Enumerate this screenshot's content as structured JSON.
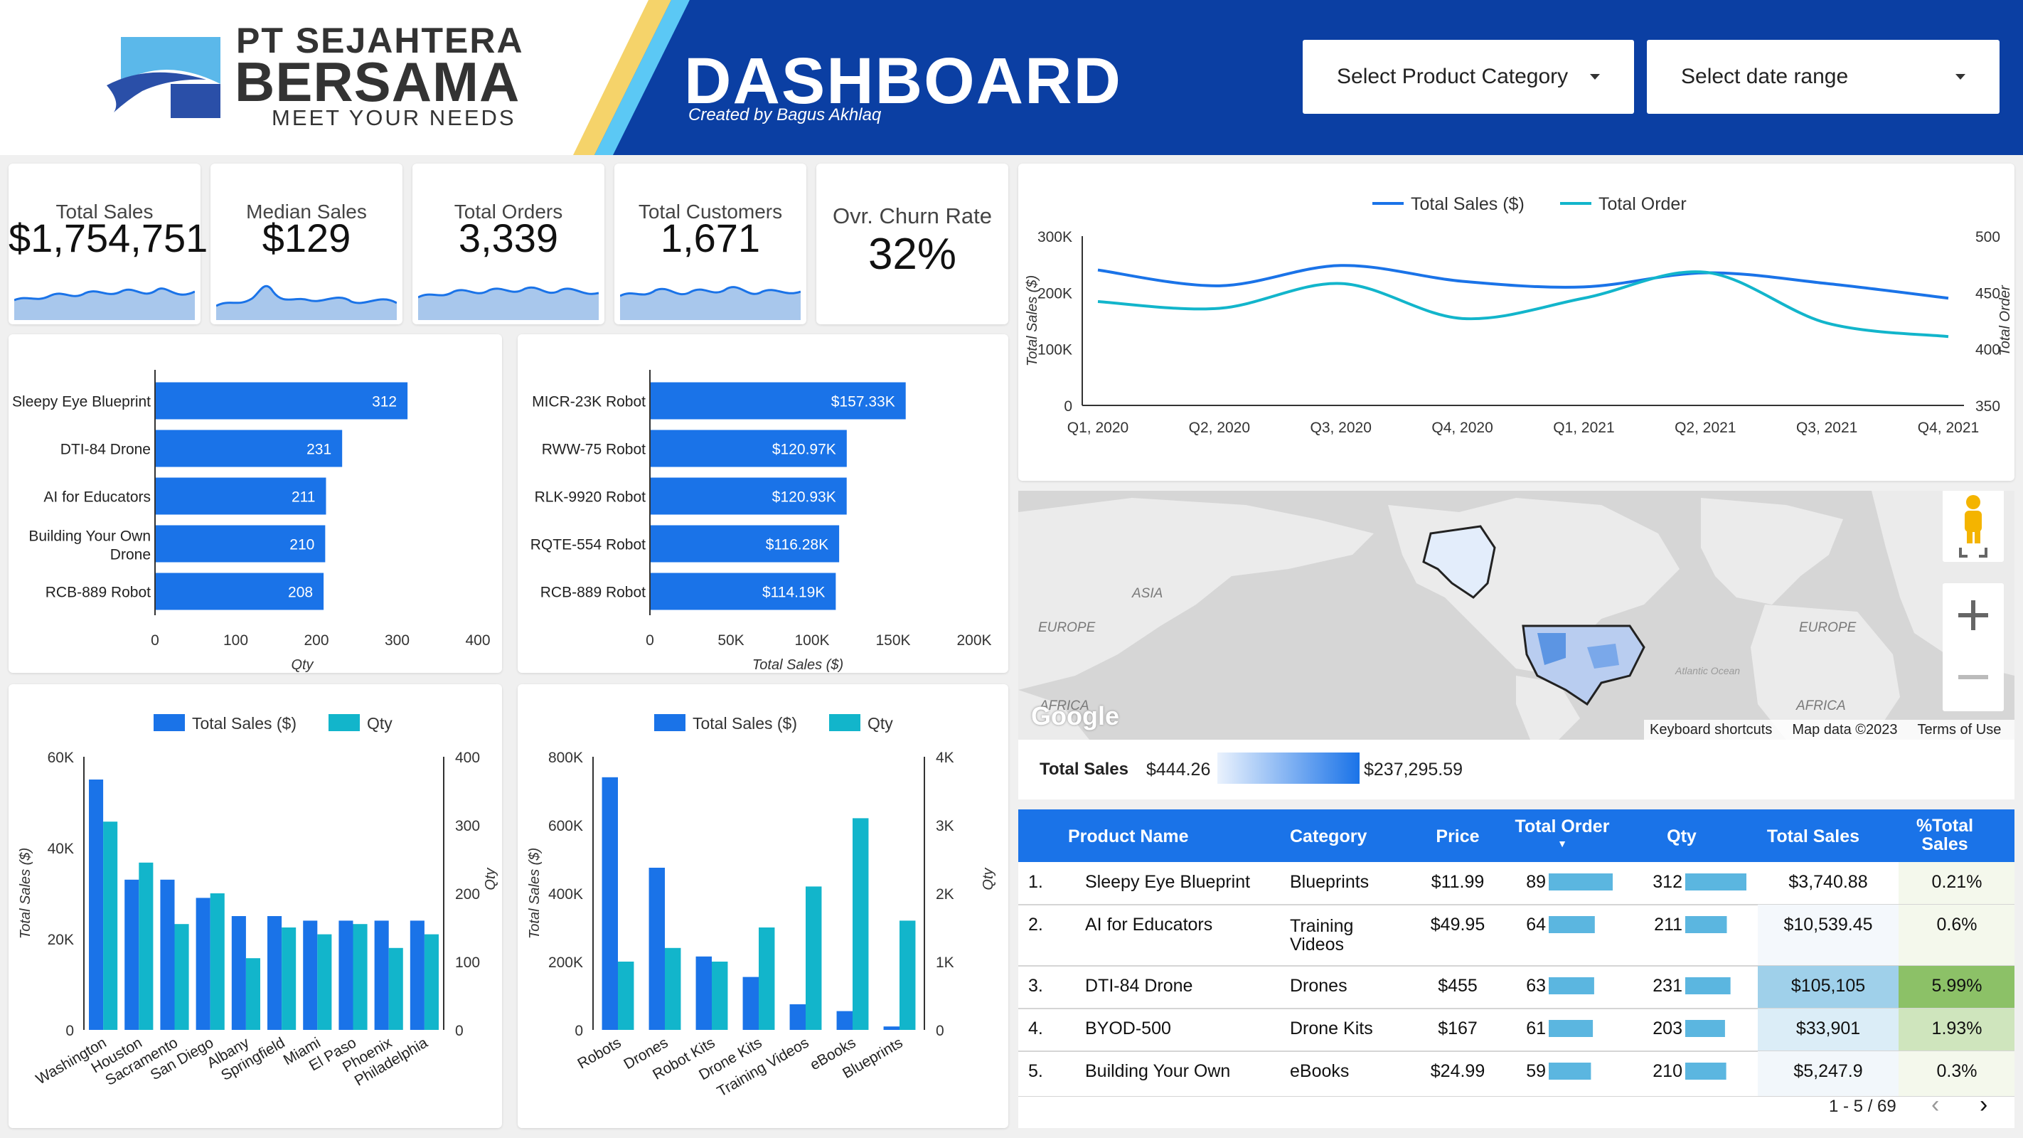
{
  "header": {
    "brand_line1": "PT SEJAHTERA",
    "brand_line2": "BERSAMA",
    "brand_line3": "MEET YOUR NEEDS",
    "title": "DASHBOARD",
    "subtitle": "Created by Bagus Akhlaq",
    "selectors": [
      {
        "label": "Select Product Category"
      },
      {
        "label": "Select date range"
      }
    ],
    "colors": {
      "blue": "#0b3fa3",
      "accent_yellow": "#f5d36a",
      "accent_cyan": "#5bc8f5"
    }
  },
  "kpis": [
    {
      "label": "Total Sales",
      "value": "$1,754,751"
    },
    {
      "label": "Median Sales",
      "value": "$129"
    },
    {
      "label": "Total Orders",
      "value": "3,339"
    },
    {
      "label": "Total Customers",
      "value": "1,671"
    },
    {
      "label": "Ovr. Churn Rate",
      "value": "32%"
    }
  ],
  "chart_data": [
    {
      "type": "line",
      "legend": [
        "Total Sales ($)",
        "Total Order"
      ],
      "x": [
        "Q1, 2020",
        "Q2, 2020",
        "Q3, 2020",
        "Q4, 2020",
        "Q1, 2021",
        "Q2, 2021",
        "Q3, 2021",
        "Q4, 2021"
      ],
      "series": [
        {
          "name": "Total Sales ($)",
          "axis": "left",
          "values": [
            240000,
            212000,
            248000,
            220000,
            210000,
            235000,
            216000,
            190000
          ],
          "color": "#1a73e8"
        },
        {
          "name": "Total Order",
          "axis": "right",
          "values": [
            442,
            436,
            458,
            427,
            445,
            468,
            423,
            411
          ],
          "color": "#12b5cb"
        }
      ],
      "ylabel": "Total Sales ($)",
      "y2label": "Total Order",
      "ylim": [
        0,
        300000
      ],
      "y2lim": [
        350,
        500
      ],
      "yticks": [
        "0",
        "100K",
        "200K",
        "300K"
      ],
      "y2ticks": [
        "350",
        "400",
        "450",
        "500"
      ]
    },
    {
      "type": "bar",
      "orientation": "horizontal",
      "categories": [
        "Sleepy Eye Blueprint",
        "DTI-84 Drone",
        "AI for Educators",
        "Building Your Own Drone",
        "RCB-889 Robot"
      ],
      "values": [
        312,
        231,
        211,
        210,
        208
      ],
      "labels": [
        "312",
        "231",
        "211",
        "210",
        "208"
      ],
      "xlabel": "Qty",
      "xlim": [
        0,
        400
      ],
      "xticks": [
        "0",
        "100",
        "200",
        "300",
        "400"
      ],
      "color": "#1a73e8"
    },
    {
      "type": "bar",
      "orientation": "horizontal",
      "categories": [
        "MICR-23K Robot",
        "RWW-75 Robot",
        "RLK-9920 Robot",
        "RQTE-554 Robot",
        "RCB-889 Robot"
      ],
      "values": [
        157330,
        120970,
        120930,
        116280,
        114190
      ],
      "labels": [
        "$157.33K",
        "$120.97K",
        "$120.93K",
        "$116.28K",
        "$114.19K"
      ],
      "xlabel": "Total Sales ($)",
      "xlim": [
        0,
        200000
      ],
      "xticks": [
        "0",
        "50K",
        "100K",
        "150K",
        "200K"
      ],
      "color": "#1a73e8"
    },
    {
      "type": "bar",
      "legend": [
        "Total Sales ($)",
        "Qty"
      ],
      "categories": [
        "Washington",
        "Houston",
        "Sacramento",
        "San Diego",
        "Albany",
        "Springfield",
        "Miami",
        "El Paso",
        "Phoenix",
        "Philadelphia"
      ],
      "series": [
        {
          "name": "Total Sales ($)",
          "axis": "left",
          "values": [
            55000,
            33000,
            33000,
            29000,
            25000,
            25000,
            24000,
            24000,
            24000,
            24000
          ],
          "color": "#1a73e8"
        },
        {
          "name": "Qty",
          "axis": "right",
          "values": [
            305,
            245,
            155,
            200,
            105,
            150,
            140,
            155,
            120,
            140
          ],
          "color": "#12b5cb"
        }
      ],
      "ylabel": "Total Sales ($)",
      "y2label": "Qty",
      "ylim": [
        0,
        60000
      ],
      "y2lim": [
        0,
        400
      ],
      "yticks": [
        "0",
        "20K",
        "40K",
        "60K"
      ],
      "y2ticks": [
        "0",
        "100",
        "200",
        "300",
        "400"
      ]
    },
    {
      "type": "bar",
      "legend": [
        "Total Sales ($)",
        "Qty"
      ],
      "categories": [
        "Robots",
        "Drones",
        "Robot Kits",
        "Drone Kits",
        "Training Videos",
        "eBooks",
        "Blueprints"
      ],
      "series": [
        {
          "name": "Total Sales ($)",
          "axis": "left",
          "values": [
            740000,
            475000,
            215000,
            155000,
            75000,
            55000,
            10000
          ],
          "color": "#1a73e8"
        },
        {
          "name": "Qty",
          "axis": "right",
          "values": [
            1000,
            1200,
            1000,
            1500,
            2100,
            3100,
            1600
          ],
          "color": "#12b5cb"
        }
      ],
      "ylabel": "Total Sales ($)",
      "y2label": "Qty",
      "ylim": [
        0,
        800000
      ],
      "y2lim": [
        0,
        4000
      ],
      "yticks": [
        "0",
        "200K",
        "400K",
        "600K",
        "800K"
      ],
      "y2ticks": [
        "0",
        "1K",
        "2K",
        "3K",
        "4K"
      ]
    }
  ],
  "map": {
    "labels": {
      "asia": "ASIA",
      "europe_left": "EUROPE",
      "europe_right": "EUROPE",
      "africa_left": "AFRICA",
      "africa_right": "AFRICA",
      "atlantic": "Atlantic Ocean"
    },
    "footer": {
      "logo": "Google",
      "shortcuts": "Keyboard shortcuts",
      "mapdata": "Map data ©2023",
      "terms": "Terms of Use"
    },
    "legend": {
      "label": "Total Sales",
      "min": "$444.26",
      "max": "$237,295.59"
    }
  },
  "table": {
    "headers": [
      "Product Name",
      "Category",
      "Price",
      "Total Order",
      "Qty",
      "Total Sales",
      "%Total Sales"
    ],
    "rows": [
      {
        "no": "1.",
        "name": "Sleepy Eye Blueprint",
        "category": "Blueprints",
        "price": "$11.99",
        "orders": "89",
        "orders_frac": 1.0,
        "qty": "312",
        "qty_frac": 1.0,
        "sales": "$3,740.88",
        "pct": "0.21%"
      },
      {
        "no": "2.",
        "name": "AI for Educators",
        "category": "Training Videos",
        "price": "$49.95",
        "orders": "64",
        "orders_frac": 0.72,
        "qty": "211",
        "qty_frac": 0.68,
        "sales": "$10,539.45",
        "pct": "0.6%"
      },
      {
        "no": "3.",
        "name": "DTI-84 Drone",
        "category": "Drones",
        "price": "$455",
        "orders": "63",
        "orders_frac": 0.71,
        "qty": "231",
        "qty_frac": 0.74,
        "sales": "$105,105",
        "pct": "5.99%"
      },
      {
        "no": "4.",
        "name": "BYOD-500",
        "category": "Drone Kits",
        "price": "$167",
        "orders": "61",
        "orders_frac": 0.69,
        "qty": "203",
        "qty_frac": 0.65,
        "sales": "$33,901",
        "pct": "1.93%"
      },
      {
        "no": "5.",
        "name": "Building Your Own",
        "category": "eBooks",
        "price": "$24.99",
        "orders": "59",
        "orders_frac": 0.66,
        "qty": "210",
        "qty_frac": 0.67,
        "sales": "$5,247.9",
        "pct": "0.3%"
      }
    ],
    "pagination": "1 - 5 / 69"
  }
}
